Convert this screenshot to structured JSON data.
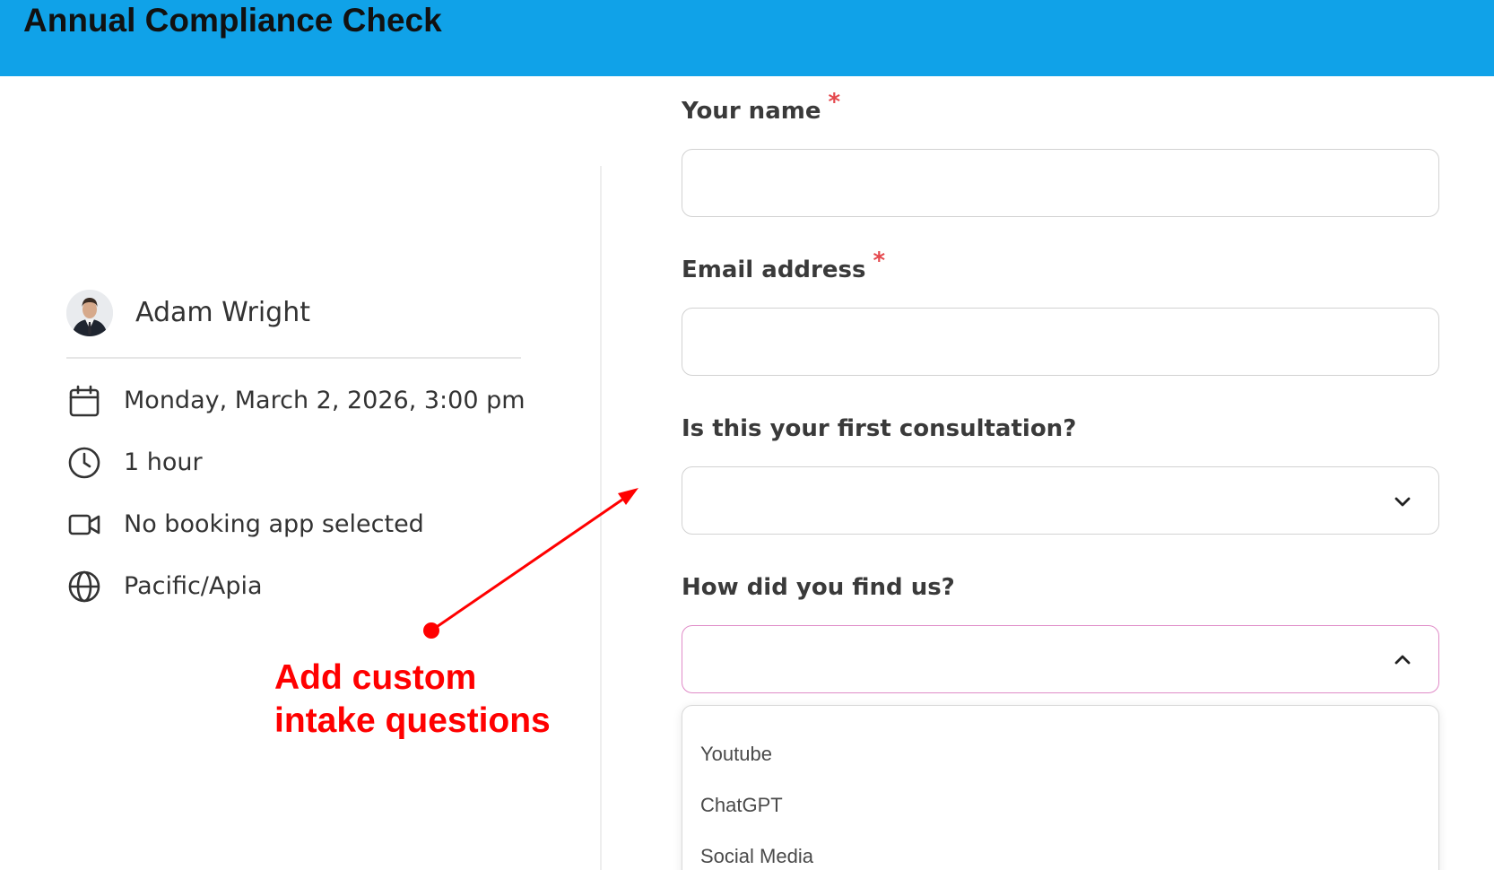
{
  "header": {
    "title": "Annual Compliance Check"
  },
  "host": {
    "name": "Adam Wright"
  },
  "details": [
    {
      "icon": "calendar-icon",
      "text": "Monday, March 2, 2026, 3:00 pm"
    },
    {
      "icon": "clock-icon",
      "text": "1 hour"
    },
    {
      "icon": "video-camera-icon",
      "text": "No booking app selected"
    },
    {
      "icon": "globe-icon",
      "text": "Pacific/Apia"
    }
  ],
  "form": {
    "required_marker": "*",
    "name_label": "Your name",
    "email_label": "Email address",
    "first_consult_label": "Is this your first consultation?",
    "find_us_label": "How did you find us?",
    "find_us_options": [
      "Youtube",
      "ChatGPT",
      "Social Media"
    ]
  },
  "annotation": {
    "line1": "Add custom",
    "line2": "intake questions"
  },
  "colors": {
    "header_bg": "#10a2e8",
    "annotation": "#ff0000",
    "required": "#e5484d",
    "focus_border": "#e08cc8"
  }
}
